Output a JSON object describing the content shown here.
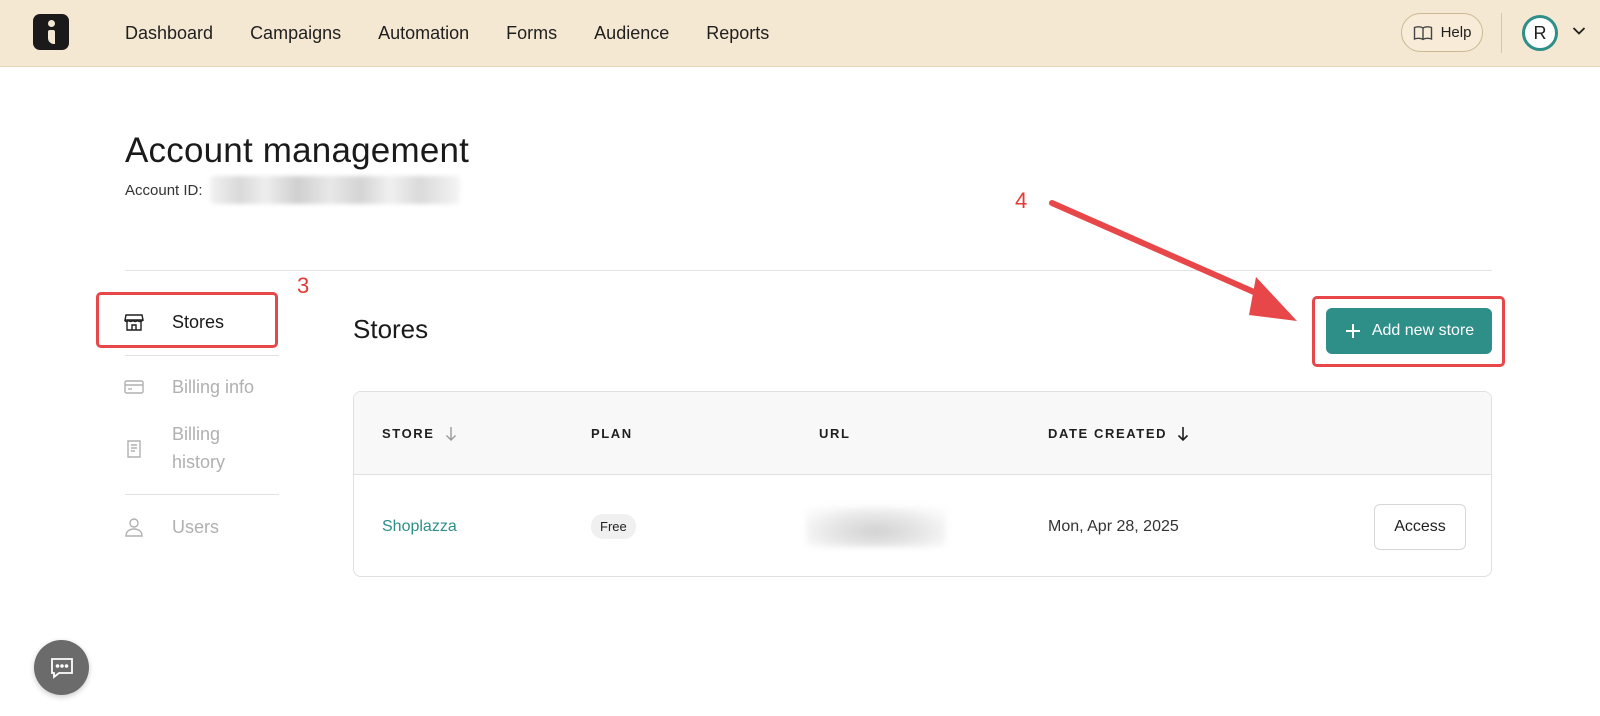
{
  "nav": {
    "items": [
      "Dashboard",
      "Campaigns",
      "Automation",
      "Forms",
      "Audience",
      "Reports"
    ],
    "help_label": "Help",
    "avatar_initial": "R"
  },
  "header": {
    "title": "Account management",
    "account_id_label": "Account ID:"
  },
  "sidebar": {
    "items": [
      {
        "label": "Stores",
        "icon": "storefront-icon",
        "active": true
      },
      {
        "label": "Billing info",
        "icon": "credit-card-icon",
        "active": false
      },
      {
        "label": "Billing history",
        "icon": "receipt-icon",
        "active": false
      },
      {
        "label": "Users",
        "icon": "user-icon",
        "active": false
      }
    ]
  },
  "main": {
    "section_title": "Stores",
    "add_button_label": "Add new store",
    "table": {
      "columns": [
        "STORE",
        "PLAN",
        "URL",
        "DATE CREATED"
      ],
      "rows": [
        {
          "store": "Shoplazza",
          "plan": "Free",
          "date_created": "Mon, Apr 28, 2025",
          "action": "Access"
        }
      ]
    }
  },
  "annotations": {
    "step_3": "3",
    "step_4": "4",
    "color": "#e53935"
  },
  "colors": {
    "topbar": "#f5e8d3",
    "accent": "#2e8e88"
  }
}
